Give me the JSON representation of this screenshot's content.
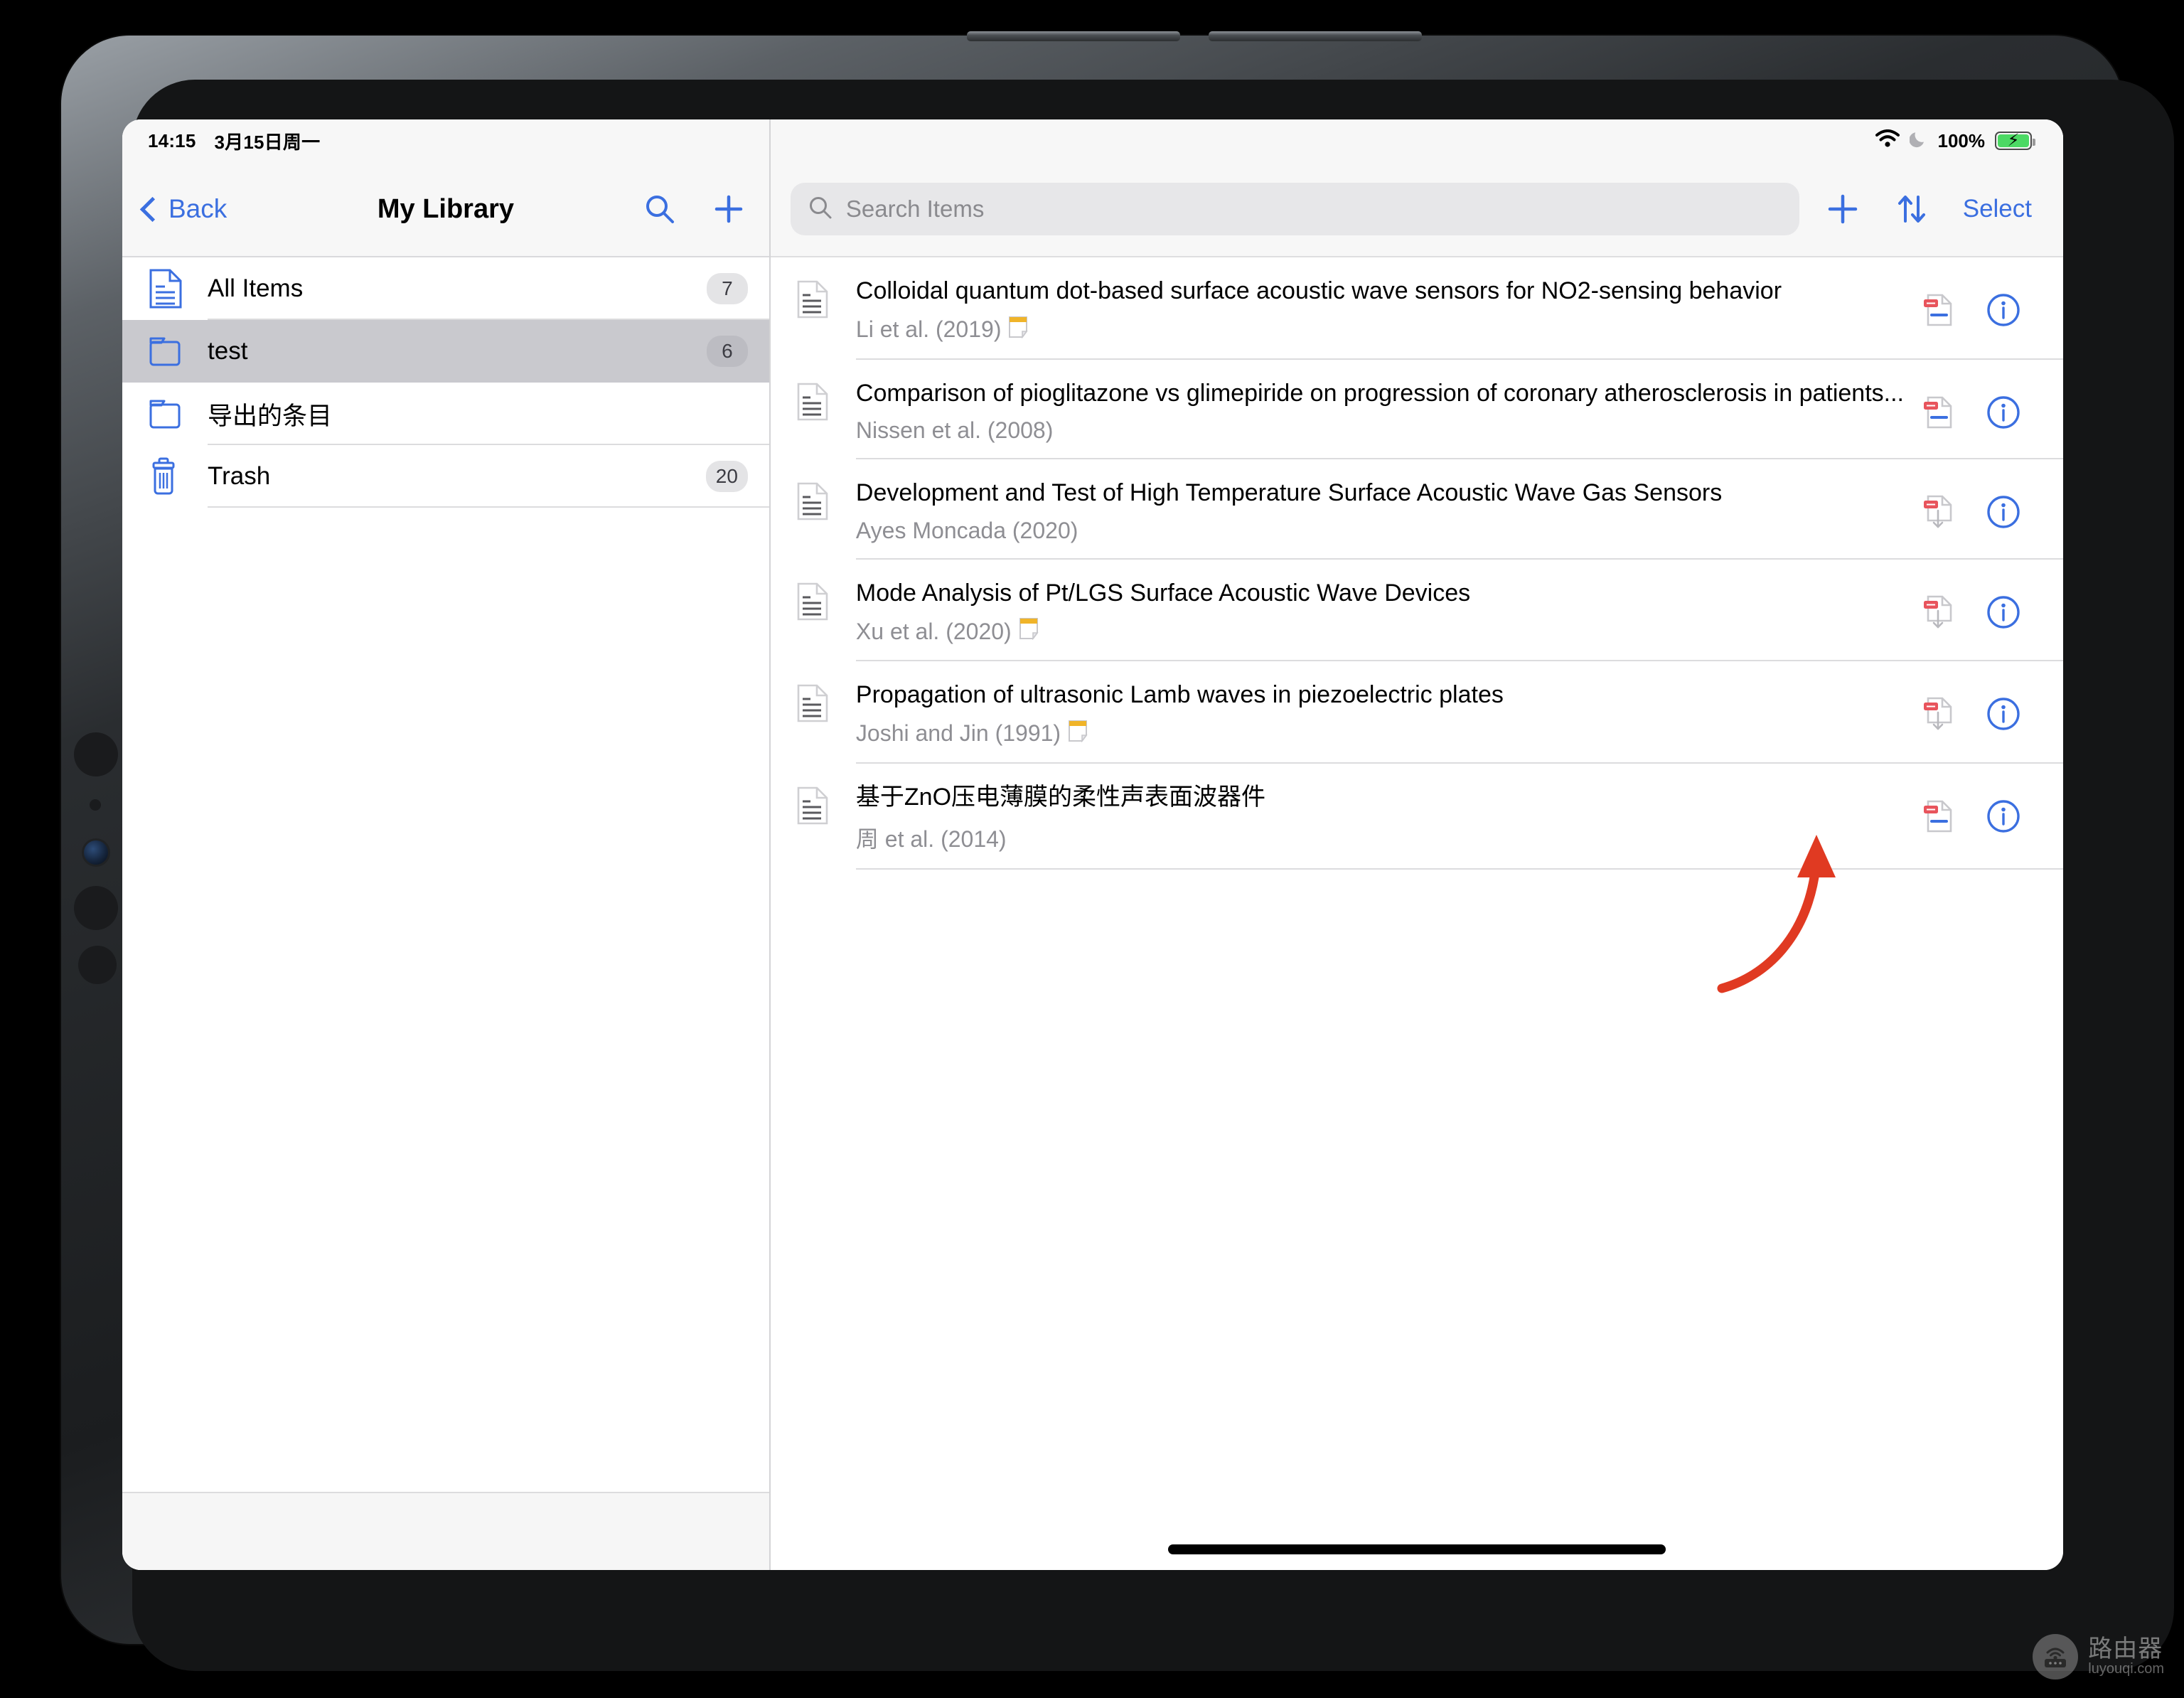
{
  "device": {
    "kind": "ipad-pro",
    "bezel_color": "#1b1d1f"
  },
  "status_bar": {
    "time": "14:15",
    "date": "3月15日周一",
    "wifi_icon": "wifi-icon",
    "dnd_icon": "moon-crescent-icon",
    "battery_percent": "100%",
    "battery_charging": true,
    "battery_color": "#4cd964"
  },
  "sidebar": {
    "back_label": "Back",
    "title": "My Library",
    "search_icon": "search-icon",
    "add_icon": "plus-icon",
    "items": [
      {
        "label": "All Items",
        "count": "7",
        "icon": "document-icon",
        "selected": false
      },
      {
        "label": "test",
        "count": "6",
        "icon": "folder-icon",
        "selected": true
      },
      {
        "label": "导出的条目",
        "count": "",
        "icon": "folder-icon",
        "selected": false
      },
      {
        "label": "Trash",
        "count": "20",
        "icon": "trash-icon",
        "selected": false
      }
    ]
  },
  "detail": {
    "search": {
      "placeholder": "Search Items",
      "value": "",
      "icon": "search-icon"
    },
    "add_icon": "plus-icon",
    "sort_icon": "sort-arrows-icon",
    "select_label": "Select",
    "items": [
      {
        "title": "Colloidal quantum dot-based surface acoustic wave sensors for NO2-sensing behavior",
        "authors": "Li et al. (2019)",
        "has_note": true,
        "attachment": "pdf-downloaded-icon",
        "info_icon": "info-circle-icon",
        "doc_icon": "document-icon"
      },
      {
        "title": "Comparison of pioglitazone vs glimepiride on progression of coronary atherosclerosis in patients...",
        "authors": "Nissen et al. (2008)",
        "has_note": false,
        "attachment": "pdf-downloaded-icon",
        "info_icon": "info-circle-icon",
        "doc_icon": "document-icon"
      },
      {
        "title": "Development and Test of High Temperature Surface Acoustic Wave Gas Sensors",
        "authors": "Ayes Moncada (2020)",
        "has_note": false,
        "attachment": "pdf-download-pending-icon",
        "info_icon": "info-circle-icon",
        "doc_icon": "document-icon"
      },
      {
        "title": "Mode Analysis of Pt/LGS Surface Acoustic Wave Devices",
        "authors": "Xu et al. (2020)",
        "has_note": true,
        "attachment": "pdf-download-pending-icon",
        "info_icon": "info-circle-icon",
        "doc_icon": "document-icon"
      },
      {
        "title": "Propagation of ultrasonic Lamb waves in piezoelectric plates",
        "authors": "Joshi and Jin (1991)",
        "has_note": true,
        "attachment": "pdf-download-pending-icon",
        "info_icon": "info-circle-icon",
        "doc_icon": "document-icon"
      },
      {
        "title": "基于ZnO压电薄膜的柔性声表面波器件",
        "authors": "周 et al. (2014)",
        "has_note": false,
        "attachment": "pdf-downloaded-icon",
        "info_icon": "info-circle-icon",
        "doc_icon": "document-icon"
      }
    ]
  },
  "annotation": {
    "arrow_color": "#e03a22",
    "arrow_name": "red-curved-arrow"
  },
  "watermark": {
    "cn": "路由器",
    "en": "luyouqi.com",
    "icon": "router-icon"
  },
  "colors": {
    "accent_blue": "#3b6fe0",
    "selected_row": "#c9c9ce",
    "toolbar_bg": "#f7f7f7",
    "secondary_text": "#8e8e93"
  }
}
